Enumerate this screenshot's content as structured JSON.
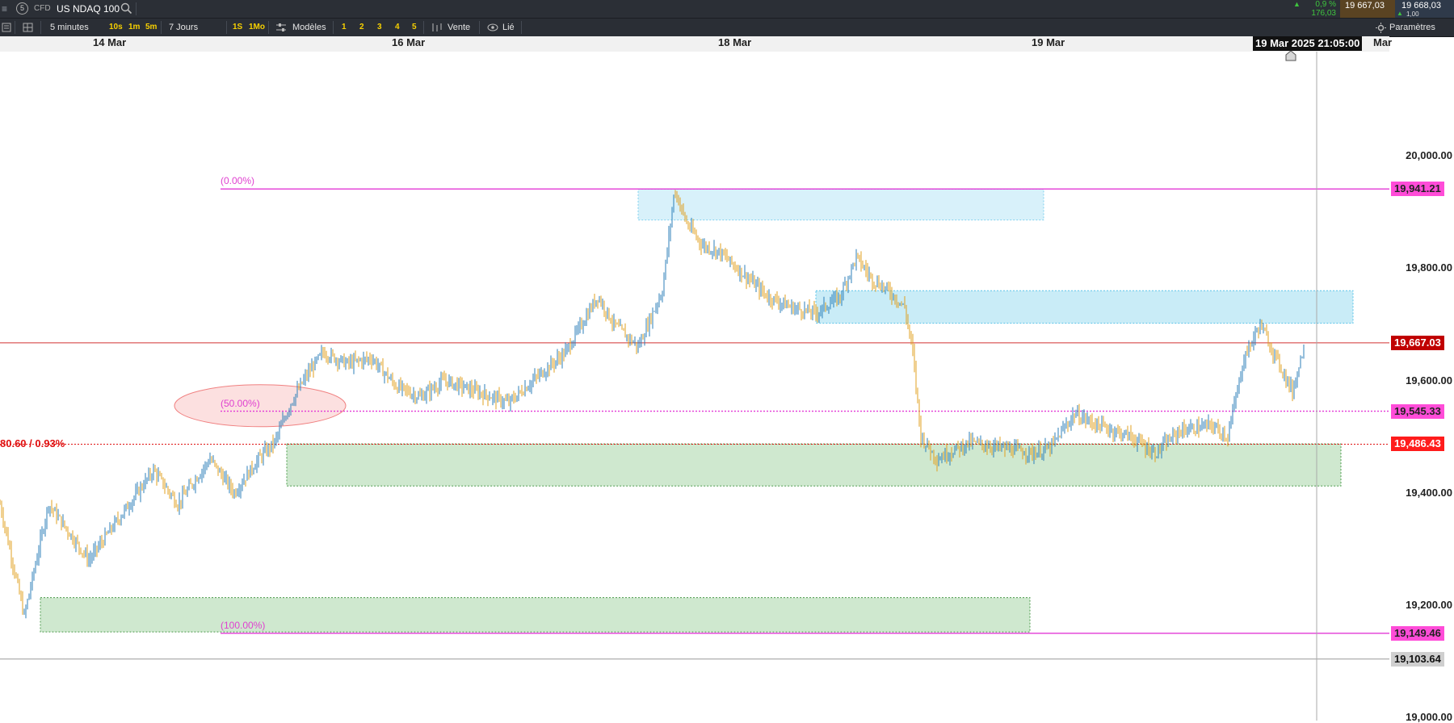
{
  "topbar": {
    "symbol_type": "CFD",
    "symbol": "US NDAQ 100",
    "change_pct": "0,9 %",
    "change_pts": "176,03",
    "bid": "19 667,03",
    "spread": "1,00",
    "ask": "19 668,03"
  },
  "toolbar": {
    "interval": "5 minutes",
    "quick_intervals": [
      "10s",
      "1m",
      "5m"
    ],
    "range": "7 Jours",
    "quick_ranges": [
      "1S",
      "1Mo"
    ],
    "models_label": "Modèles",
    "presets": [
      "1",
      "2",
      "3",
      "4",
      "5"
    ],
    "sell_label": "Vente",
    "linked_label": "Lié",
    "settings_label": "Paramètres"
  },
  "chart_data": {
    "type": "candlestick",
    "x_ticks": [
      "14 Mar",
      "16 Mar",
      "18 Mar",
      "19 Mar"
    ],
    "crosshair_time": "19 Mar 2025 21:05:00",
    "x_cut_label": "Mar",
    "y_ticks": [
      "20,000.00",
      "19,800.00",
      "19,600.00",
      "19,400.00",
      "19,200.00",
      "19,000.00"
    ],
    "ylim": [
      18950,
      20180
    ],
    "current_price": "19,667.03",
    "hline_prices": [
      {
        "value": "19,941.21",
        "price": 19941.21,
        "fib": "(0.00%)"
      },
      {
        "value": "19,545.33",
        "price": 19545.33,
        "fib": "(50.00%)"
      },
      {
        "value": "19,149.46",
        "price": 19149.46,
        "fib": "(100.00%)"
      }
    ],
    "red_level": {
      "value": "19,486.43",
      "price": 19486.43,
      "label": "80.60 / 0.93%"
    },
    "crosshair_price": {
      "value": "19,103.64",
      "price": 19103.64
    },
    "trend_points": [
      [
        0,
        19380
      ],
      [
        30,
        19180
      ],
      [
        60,
        19380
      ],
      [
        110,
        19280
      ],
      [
        150,
        19360
      ],
      [
        190,
        19440
      ],
      [
        220,
        19380
      ],
      [
        260,
        19460
      ],
      [
        290,
        19400
      ],
      [
        320,
        19460
      ],
      [
        340,
        19490
      ],
      [
        360,
        19560
      ],
      [
        380,
        19610
      ],
      [
        400,
        19650
      ],
      [
        430,
        19630
      ],
      [
        460,
        19640
      ],
      [
        490,
        19590
      ],
      [
        520,
        19570
      ],
      [
        550,
        19600
      ],
      [
        590,
        19580
      ],
      [
        630,
        19560
      ],
      [
        660,
        19600
      ],
      [
        700,
        19650
      ],
      [
        740,
        19750
      ],
      [
        760,
        19700
      ],
      [
        790,
        19660
      ],
      [
        820,
        19760
      ],
      [
        835,
        19940
      ],
      [
        850,
        19880
      ],
      [
        870,
        19840
      ],
      [
        890,
        19830
      ],
      [
        920,
        19790
      ],
      [
        950,
        19750
      ],
      [
        980,
        19730
      ],
      [
        1010,
        19720
      ],
      [
        1040,
        19750
      ],
      [
        1060,
        19820
      ],
      [
        1080,
        19780
      ],
      [
        1100,
        19760
      ],
      [
        1120,
        19730
      ],
      [
        1130,
        19650
      ],
      [
        1140,
        19500
      ],
      [
        1160,
        19460
      ],
      [
        1200,
        19490
      ],
      [
        1240,
        19480
      ],
      [
        1280,
        19470
      ],
      [
        1300,
        19480
      ],
      [
        1330,
        19540
      ],
      [
        1360,
        19520
      ],
      [
        1400,
        19500
      ],
      [
        1430,
        19470
      ],
      [
        1460,
        19510
      ],
      [
        1500,
        19520
      ],
      [
        1520,
        19500
      ],
      [
        1540,
        19640
      ],
      [
        1560,
        19700
      ],
      [
        1580,
        19640
      ],
      [
        1600,
        19580
      ],
      [
        1614,
        19660
      ]
    ]
  }
}
